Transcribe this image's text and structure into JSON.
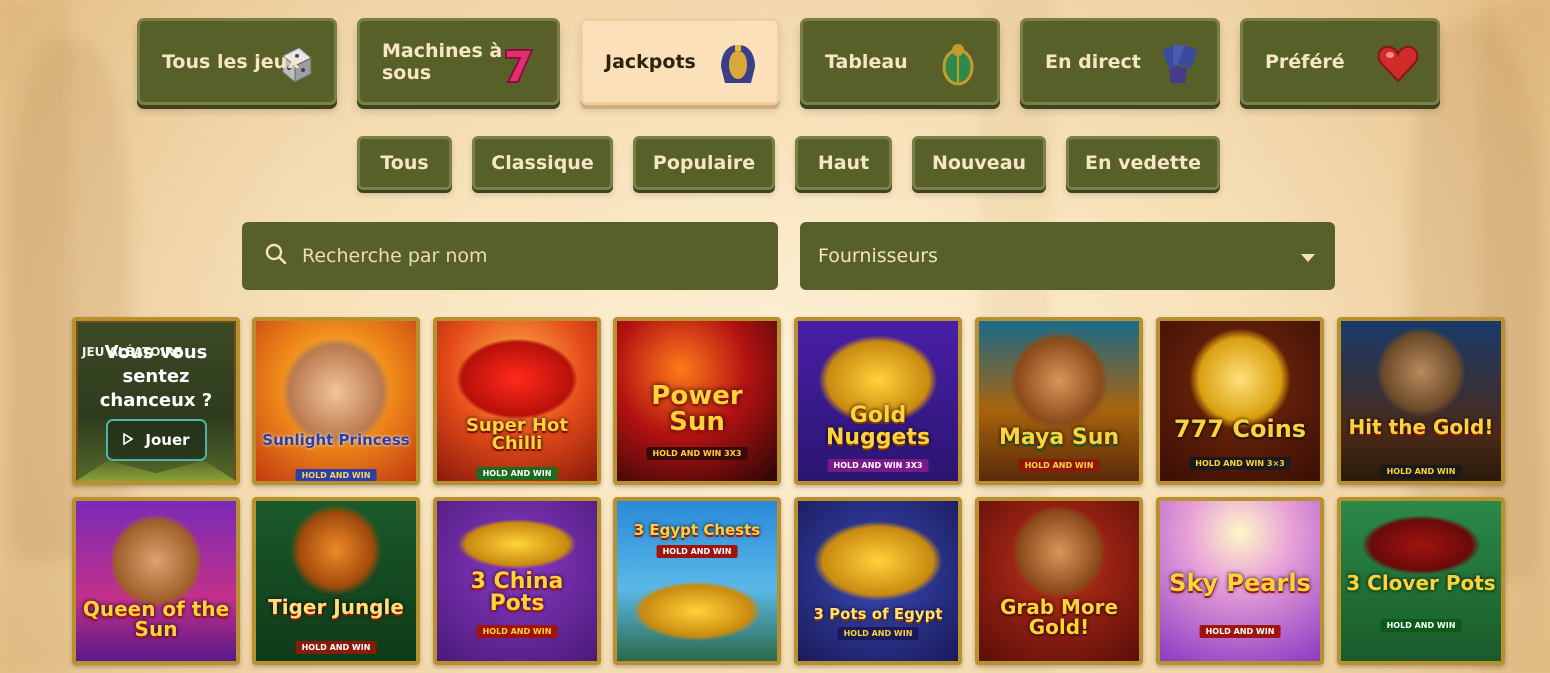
{
  "categories": [
    {
      "label": "Tous les jeux",
      "icon": "dice-icon",
      "active": false
    },
    {
      "label": "Machines à sous",
      "icon": "lucky-seven-icon",
      "active": false
    },
    {
      "label": "Jackpots",
      "icon": "pharaoh-mask-icon",
      "active": true
    },
    {
      "label": "Tableau",
      "icon": "scarab-icon",
      "active": false
    },
    {
      "label": "En direct",
      "icon": "playing-cards-hand-icon",
      "active": false
    },
    {
      "label": "Préféré",
      "icon": "heart-icon",
      "active": false
    }
  ],
  "filters": [
    "Tous",
    "Classique",
    "Populaire",
    "Haut",
    "Nouveau",
    "En vedette"
  ],
  "search": {
    "placeholder": "Recherche par nom",
    "icon": "search-icon"
  },
  "provider": {
    "label": "Fournisseurs",
    "icon": "dropdown-arrow-icon"
  },
  "promo": {
    "tag": "JEU ALÉATOIRE",
    "message": "Vous vous sentez chanceux ?",
    "play_label": "Jouer"
  },
  "games": [
    {
      "title": "Sunlight Princess",
      "strap": "HOLD AND WIN"
    },
    {
      "title": "Super Hot Chilli",
      "strap": "HOLD AND WIN"
    },
    {
      "title": "Power Sun",
      "strap": "HOLD AND WIN 3X3"
    },
    {
      "title": "Gold Nuggets",
      "strap": "HOLD AND WIN 3X3"
    },
    {
      "title": "Maya Sun",
      "strap": "HOLD AND WIN"
    },
    {
      "title": "777 Coins",
      "strap": "HOLD AND WIN 3×3"
    },
    {
      "title": "Hit the Gold!",
      "strap": "HOLD AND WIN"
    },
    {
      "title": "Queen of the Sun",
      "strap": ""
    },
    {
      "title": "Tiger Jungle",
      "strap": "HOLD AND WIN"
    },
    {
      "title": "3 China Pots",
      "strap": "HOLD AND WIN"
    },
    {
      "title": "3 Egypt Chests",
      "strap": "HOLD AND WIN"
    },
    {
      "title": "3 Pots of Egypt",
      "strap": "HOLD AND WIN"
    },
    {
      "title": "Grab More Gold!",
      "strap": ""
    },
    {
      "title": "Sky Pearls",
      "strap": "HOLD AND WIN"
    },
    {
      "title": "3 Clover Pots",
      "strap": "HOLD AND WIN"
    }
  ],
  "colors": {
    "panel": "#58602a",
    "active": "#fbe0b9",
    "text_light": "#f7e6c3",
    "tile_border": "#b8902f"
  }
}
